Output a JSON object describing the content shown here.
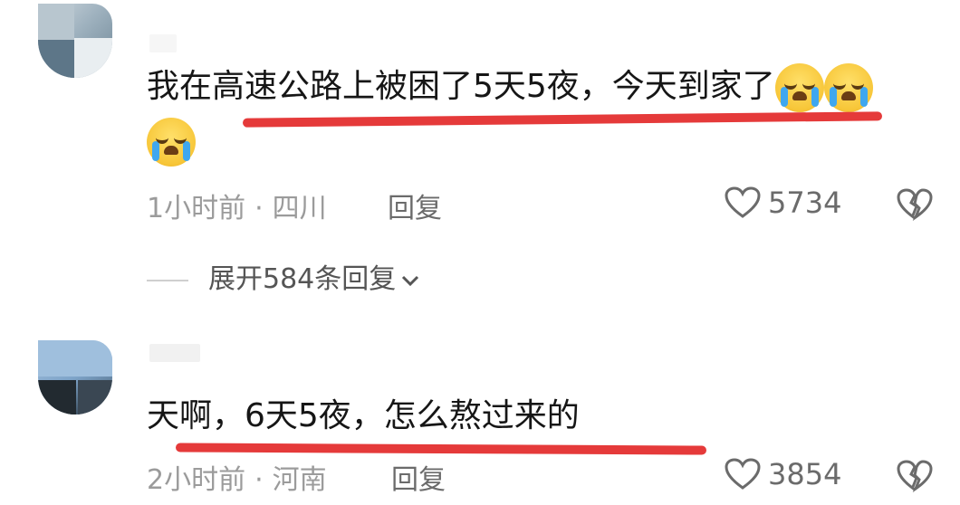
{
  "comments": [
    {
      "text": "我在高速公路上被困了5天5夜，今天到家了",
      "emoji_count": 3,
      "time": "1小时前",
      "location": "四川",
      "reply_label": "回复",
      "likes": "5734",
      "expand_label": "展开584条回复"
    },
    {
      "text": "天啊，6天5夜，怎么熬过来的",
      "time": "2小时前",
      "location": "河南",
      "reply_label": "回复",
      "likes": "3854"
    }
  ],
  "separator": "·",
  "colors": {
    "underline": "#e53a3a",
    "meta": "#9b9b9b",
    "text": "#161616"
  },
  "icons": [
    "loudly-crying-face-emoji",
    "heart-outline-icon",
    "broken-heart-icon",
    "chevron-down-icon"
  ]
}
